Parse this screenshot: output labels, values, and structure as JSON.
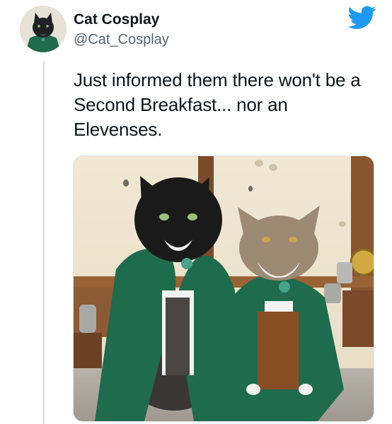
{
  "tweet": {
    "display_name": "Cat Cosplay",
    "handle": "@Cat_Cosplay",
    "text": "Just informed them there won't be a Second Breakfast... nor an Elevenses."
  },
  "icons": {
    "brand": "twitter-bird-icon"
  },
  "colors": {
    "twitter_blue": "#1d9bf0",
    "name_text": "#0f1419",
    "handle_text": "#536471",
    "cloak_green": "#1f6b4d",
    "thread_line": "#d6d9dc"
  }
}
